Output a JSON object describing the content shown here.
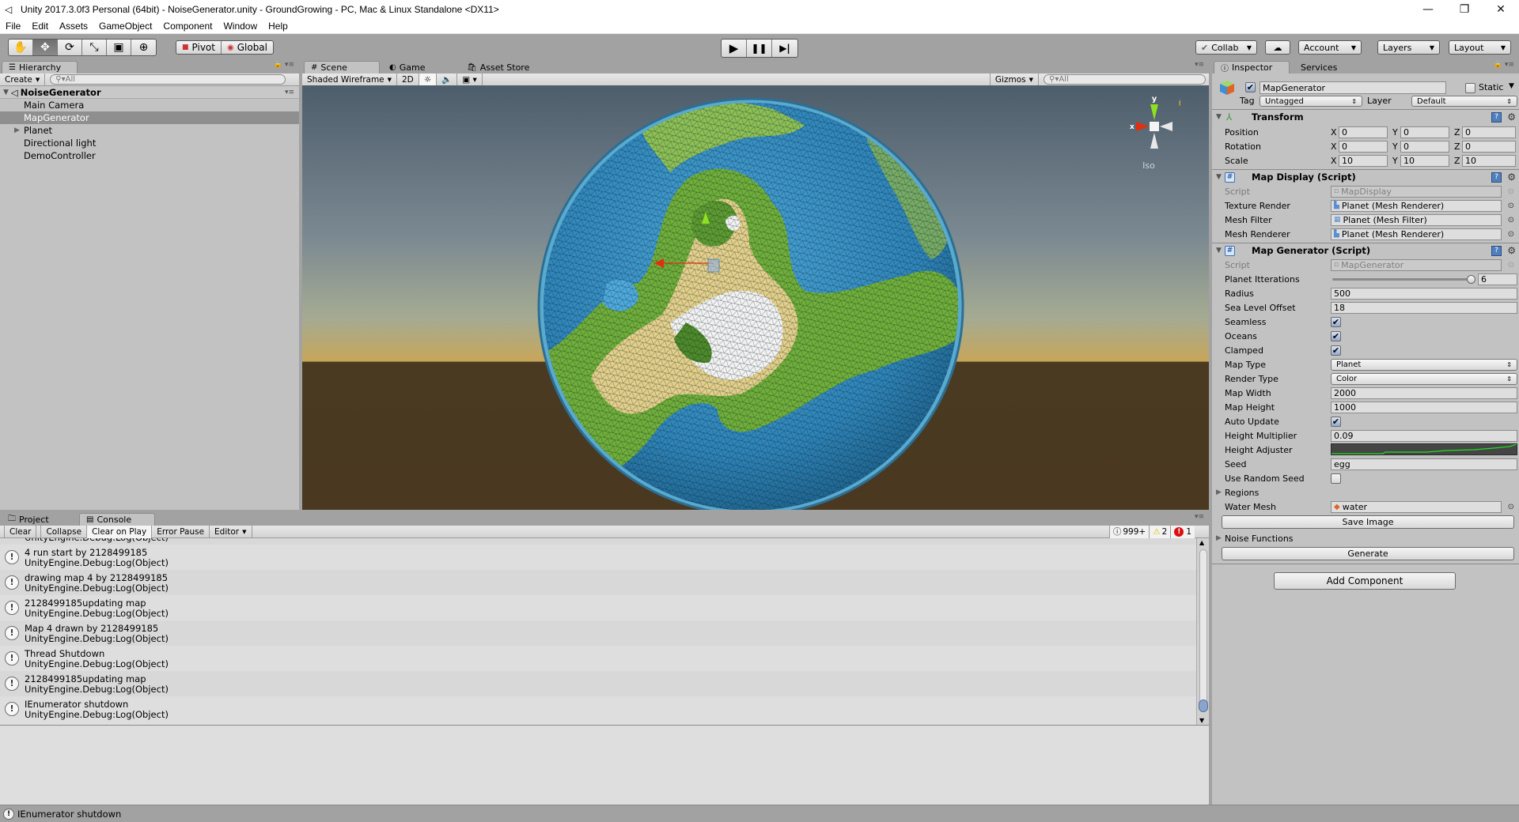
{
  "window": {
    "title": "Unity 2017.3.0f3 Personal (64bit) - NoiseGenerator.unity - GroundGrowing - PC, Mac & Linux Standalone <DX11>",
    "controls": {
      "minimize": "—",
      "maximize": "❐",
      "close": "✕"
    }
  },
  "menu": [
    "File",
    "Edit",
    "Assets",
    "GameObject",
    "Component",
    "Window",
    "Help"
  ],
  "toolbar": {
    "tools": [
      {
        "name": "hand-tool",
        "glyph": "✋"
      },
      {
        "name": "move-tool",
        "glyph": "✥"
      },
      {
        "name": "rotate-tool",
        "glyph": "⟳"
      },
      {
        "name": "scale-tool",
        "glyph": "⤡"
      },
      {
        "name": "rect-tool",
        "glyph": "▣"
      },
      {
        "name": "transform-tool",
        "glyph": "⊕"
      }
    ],
    "active_tool": "move-tool",
    "pivot_label": "Pivot",
    "global_label": "Global",
    "play": {
      "play": "▶",
      "pause": "❚❚",
      "step": "▶|"
    },
    "collab_label": "Collab",
    "account_label": "Account",
    "layers_label": "Layers",
    "layout_label": "Layout"
  },
  "hierarchy": {
    "tab_label": "Hierarchy",
    "create_label": "Create",
    "search_placeholder": "All",
    "scene_name": "NoiseGenerator",
    "items": [
      {
        "label": "Main Camera",
        "selected": false,
        "expandable": false
      },
      {
        "label": "MapGenerator",
        "selected": true,
        "expandable": false
      },
      {
        "label": "Planet",
        "selected": false,
        "expandable": true
      },
      {
        "label": "Directional light",
        "selected": false,
        "expandable": false
      },
      {
        "label": "DemoController",
        "selected": false,
        "expandable": false
      }
    ]
  },
  "scene": {
    "tabs": [
      {
        "label": "Scene",
        "icon": "#",
        "active": true
      },
      {
        "label": "Game",
        "icon": "◐",
        "active": false
      },
      {
        "label": "Asset Store",
        "icon": "🛍",
        "active": false
      }
    ],
    "draw_mode": "Shaded Wireframe",
    "mode_2d_label": "2D",
    "gizmos_label": "Gizmos",
    "search_placeholder": "All",
    "projection_label": "Iso",
    "axis_x": "x",
    "axis_y": "y"
  },
  "inspector": {
    "tabs": [
      {
        "label": "Inspector",
        "active": true
      },
      {
        "label": "Services",
        "active": false
      }
    ],
    "object_name": "MapGenerator",
    "active": true,
    "static_label": "Static",
    "tag_label": "Tag",
    "tag_value": "Untagged",
    "layer_label": "Layer",
    "layer_value": "Default",
    "transform": {
      "title": "Transform",
      "rows": [
        {
          "label": "Position",
          "x": "0",
          "y": "0",
          "z": "0"
        },
        {
          "label": "Rotation",
          "x": "0",
          "y": "0",
          "z": "0"
        },
        {
          "label": "Scale",
          "x": "10",
          "y": "10",
          "z": "10"
        }
      ]
    },
    "map_display": {
      "title": "Map Display (Script)",
      "script_label": "Script",
      "script_value": "MapDisplay",
      "texture_render_label": "Texture Render",
      "texture_render_value": "Planet (Mesh Renderer)",
      "mesh_filter_label": "Mesh Filter",
      "mesh_filter_value": "Planet (Mesh Filter)",
      "mesh_renderer_label": "Mesh Renderer",
      "mesh_renderer_value": "Planet (Mesh Renderer)"
    },
    "map_generator": {
      "title": "Map Generator (Script)",
      "script_label": "Script",
      "script_value": "MapGenerator",
      "planet_iterations_label": "Planet Itterations",
      "planet_iterations_value": "6",
      "planet_iterations_fraction": 1.0,
      "radius_label": "Radius",
      "radius_value": "500",
      "sea_level_label": "Sea Level Offset",
      "sea_level_value": "18",
      "seamless_label": "Seamless",
      "seamless": true,
      "oceans_label": "Oceans",
      "oceans": true,
      "clamped_label": "Clamped",
      "clamped": true,
      "map_type_label": "Map Type",
      "map_type_value": "Planet",
      "render_type_label": "Render Type",
      "render_type_value": "Color",
      "map_width_label": "Map Width",
      "map_width_value": "2000",
      "map_height_label": "Map Height",
      "map_height_value": "1000",
      "auto_update_label": "Auto Update",
      "auto_update": true,
      "height_multiplier_label": "Height Multiplier",
      "height_multiplier_value": "0.09",
      "height_adjuster_label": "Height Adjuster",
      "seed_label": "Seed",
      "seed_value": "egg",
      "use_random_seed_label": "Use Random Seed",
      "use_random_seed": false,
      "regions_label": "Regions",
      "water_mesh_label": "Water Mesh",
      "water_mesh_value": "water",
      "save_image_label": "Save Image",
      "noise_functions_label": "Noise Functions",
      "generate_label": "Generate"
    },
    "add_component_label": "Add Component"
  },
  "console": {
    "tabs": [
      {
        "label": "Project",
        "active": false
      },
      {
        "label": "Console",
        "active": true
      }
    ],
    "buttons": {
      "clear": "Clear",
      "collapse": "Collapse",
      "clear_on_play": "Clear on Play",
      "error_pause": "Error Pause",
      "editor": "Editor"
    },
    "counts": {
      "log": "999+",
      "warning": "2",
      "error": "1"
    },
    "partial_top_line": "UnityEngine.Debug:Log(Object)",
    "entries": [
      {
        "message": "4 run start by 2128499185",
        "trace": "UnityEngine.Debug:Log(Object)"
      },
      {
        "message": "drawing map 4 by 2128499185",
        "trace": "UnityEngine.Debug:Log(Object)"
      },
      {
        "message": "2128499185updating map",
        "trace": "UnityEngine.Debug:Log(Object)"
      },
      {
        "message": "Map 4 drawn by 2128499185",
        "trace": "UnityEngine.Debug:Log(Object)"
      },
      {
        "message": "Thread Shutdown",
        "trace": "UnityEngine.Debug:Log(Object)"
      },
      {
        "message": "2128499185updating map",
        "trace": "UnityEngine.Debug:Log(Object)"
      },
      {
        "message": "IEnumerator shutdown",
        "trace": "UnityEngine.Debug:Log(Object)"
      }
    ],
    "scroll_fraction": 1.0
  },
  "status_bar": {
    "message": "IEnumerator shutdown"
  },
  "colors": {
    "panel_bg": "#c2c2c2",
    "selection": "#8f8f8f",
    "ocean": "#3a8fc2",
    "land_green": "#6fae3a",
    "sand": "#e2cf8a",
    "snow": "#f2f2f2",
    "curve": "#21e021",
    "axis_x": "#e03010",
    "axis_y": "#8ee020"
  }
}
